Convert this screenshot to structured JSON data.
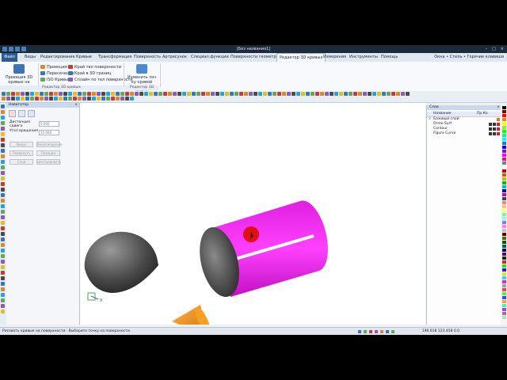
{
  "window": {
    "title": "[Без названия1]"
  },
  "menu": {
    "file": "Файл",
    "tabs": [
      "Виды",
      "Редактирование",
      "Кривые",
      "Трансформация",
      "Поверхность",
      "Артрисунок",
      "Специал.функции",
      "Поверхности геометрии",
      "Редактор 3D кривых",
      "Измерения",
      "Инструменты",
      "Помощь"
    ],
    "active_tab": "Редактор 3D кривых",
    "right_info": "Окна • Стиль • Горячие клавиши"
  },
  "ribbon": {
    "big_button": "Проекция 3D кривых на плоскость",
    "group1_items": [
      "Проекция",
      "Пересечение",
      "ISO Кривые"
    ],
    "group2_items": [
      "Край твл поверхности",
      "Край в 3D границ",
      "Сплайн по тел поверхности"
    ],
    "group1_label": "Редактор 3D кривых",
    "change_button": "Изменить точ ку кривой",
    "group2_label": "Редактор 3D кривых"
  },
  "nav_panel": {
    "title": "Навигатор",
    "shift_distance_label": "Дистанция сдвига",
    "shift_distance_value": "5.000",
    "rotation_angle_label": "Угол вращения",
    "rotation_angle_value": "15.000",
    "buttons": [
      "Вверх",
      "Внизсмещение",
      "Повернуть",
      "Позиции",
      "Слой",
      "Центрировать"
    ]
  },
  "layers": {
    "title": "Слои",
    "col_name": "Название",
    "col_right": "Пр  Ко",
    "rows": [
      {
        "name": "Базовый слой",
        "color": "#e0742a"
      },
      {
        "name": "Orme Surf",
        "color": "#d32020"
      },
      {
        "name": "Contour",
        "color": "#d32020"
      },
      {
        "name": "Figure Curve",
        "color": "#d32020"
      }
    ]
  },
  "status": {
    "left": "Рисовать кривые на поверхности · Выберите точку на поверхности",
    "coords": "196.618 123.458 0.0"
  },
  "viewport": {
    "axis_label": "X",
    "shapes": [
      "hemisphere",
      "cylinder",
      "cone",
      "red-point"
    ]
  }
}
